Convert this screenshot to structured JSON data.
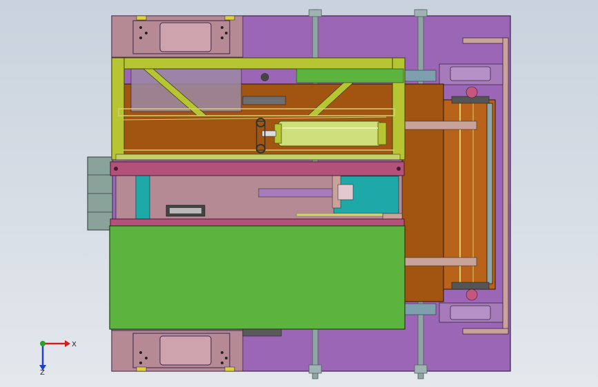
{
  "viewport": {
    "background_top": "#c9d2dd",
    "background_bottom": "#e4e8ed"
  },
  "model": {
    "colors": {
      "base_plate": "#9b66b6",
      "base_plate_dark": "#7d4f96",
      "mount_block": "#b58a95",
      "frame_yellow": "#b7c532",
      "frame_yellow_dark": "#6e7a10",
      "plate_brown": "#a15510",
      "plate_brown_dark": "#7c3e08",
      "cover_green": "#5cb43e",
      "rail_pink": "#b2527a",
      "cyan_block": "#1fa8a8",
      "grey_box": "#8aa39a",
      "cylinder": "#cfe07a",
      "shaft": "#8fa5a3",
      "bracket_tan": "#c9a39a"
    }
  },
  "triad": {
    "x_label": "X",
    "z_label": "Z",
    "x_color": "#d21c1c",
    "y_color": "#2aa32a",
    "z_color": "#1c3fd2"
  }
}
